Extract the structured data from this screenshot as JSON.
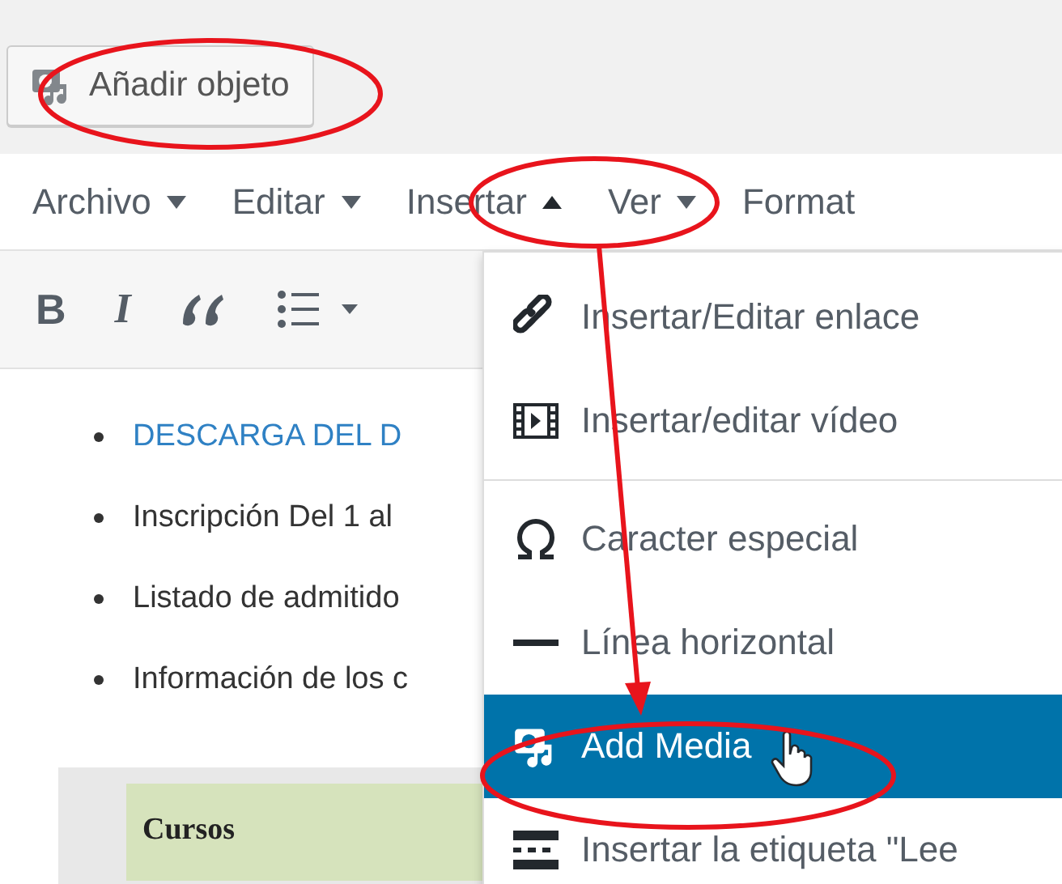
{
  "add_media_button": {
    "label": "Añadir objeto"
  },
  "menubar": [
    {
      "label": "Archivo",
      "expanded": false
    },
    {
      "label": "Editar",
      "expanded": false
    },
    {
      "label": "Insertar",
      "expanded": true
    },
    {
      "label": "Ver",
      "expanded": false
    },
    {
      "label": "Format"
    }
  ],
  "toolbar": [
    {
      "kind": "bold",
      "label": "B"
    },
    {
      "kind": "italic",
      "label": "I"
    },
    {
      "kind": "quote"
    },
    {
      "kind": "list"
    }
  ],
  "content": {
    "items": [
      {
        "text": "DESCARGA DEL D",
        "kind": "link"
      },
      {
        "text": "Inscripción Del 1 al",
        "kind": "text"
      },
      {
        "text": "Listado de admitido",
        "kind": "text"
      },
      {
        "text": "Información de los c",
        "kind": "text"
      }
    ],
    "table": {
      "header": "Cursos"
    }
  },
  "dropdown": {
    "items": [
      {
        "kind": "link",
        "label": "Insertar/Editar enlace",
        "selected": false
      },
      {
        "kind": "video",
        "label": "Insertar/editar vídeo",
        "selected": false
      },
      {
        "kind": "divider"
      },
      {
        "kind": "omega",
        "label": "Caracter especial",
        "selected": false
      },
      {
        "kind": "hr",
        "label": "Línea horizontal",
        "selected": false
      },
      {
        "kind": "media",
        "label": "Add Media",
        "selected": true
      },
      {
        "kind": "more",
        "label": "Insertar la etiqueta \"Lee",
        "selected": false
      }
    ]
  }
}
